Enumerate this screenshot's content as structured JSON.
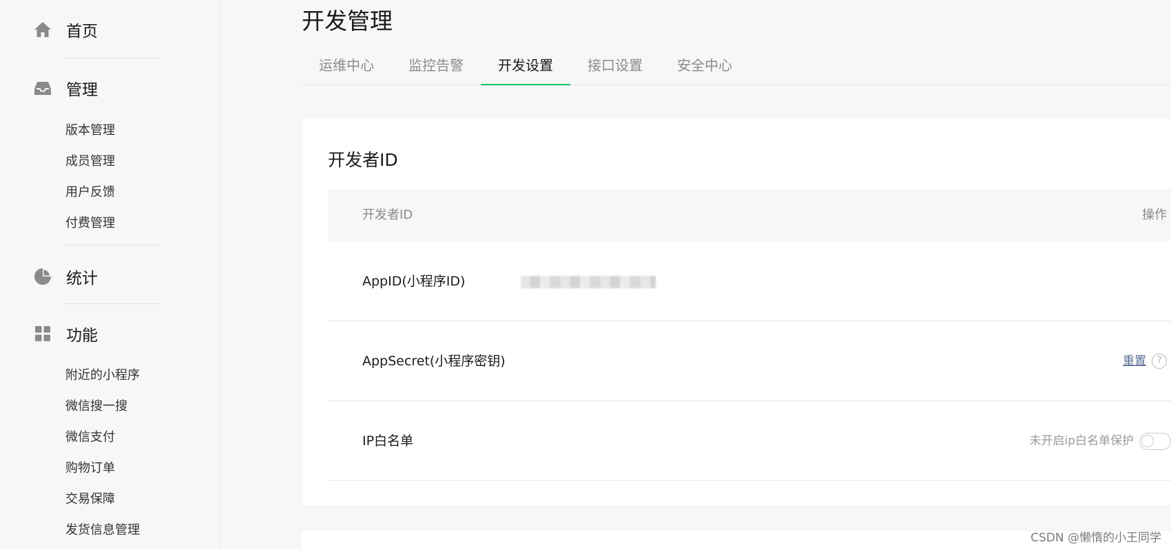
{
  "sidebar": {
    "home": {
      "label": "首页",
      "icon": "home-icon"
    },
    "manage": {
      "label": "管理",
      "icon": "inbox-icon",
      "items": [
        {
          "label": "版本管理"
        },
        {
          "label": "成员管理"
        },
        {
          "label": "用户反馈"
        },
        {
          "label": "付费管理"
        }
      ]
    },
    "stats": {
      "label": "统计",
      "icon": "pie-chart-icon"
    },
    "features": {
      "label": "功能",
      "icon": "grid-icon",
      "items": [
        {
          "label": "附近的小程序"
        },
        {
          "label": "微信搜一搜"
        },
        {
          "label": "微信支付"
        },
        {
          "label": "购物订单"
        },
        {
          "label": "交易保障"
        },
        {
          "label": "发货信息管理"
        }
      ]
    }
  },
  "main": {
    "title": "开发管理",
    "tabs": [
      {
        "label": "运维中心",
        "active": false
      },
      {
        "label": "监控告警",
        "active": false
      },
      {
        "label": "开发设置",
        "active": true
      },
      {
        "label": "接口设置",
        "active": false
      },
      {
        "label": "安全中心",
        "active": false
      }
    ],
    "card": {
      "title": "开发者ID",
      "columns": [
        "开发者ID",
        "操作"
      ],
      "rows": {
        "appid": {
          "label": "AppID(小程序ID)"
        },
        "secret": {
          "label": "AppSecret(小程序密钥)",
          "action": "重置",
          "help_icon": "question-circle-icon"
        },
        "ip": {
          "label": "IP白名单",
          "status": "未开启ip白名单保护",
          "toggle_on": false
        }
      }
    }
  },
  "watermark": "CSDN @懒惰的小王同学",
  "colors": {
    "accent": "#07c160",
    "link": "#576b95",
    "icon_gray": "#8a8a8a"
  }
}
